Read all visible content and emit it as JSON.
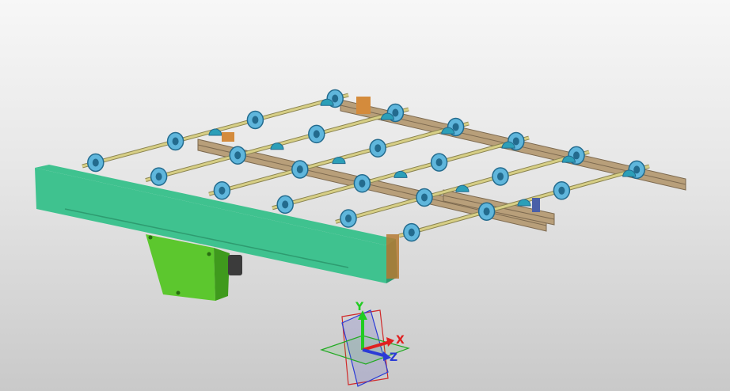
{
  "viewport": {
    "name": "3d-cad-viewport",
    "background_top": "#f7f7f7",
    "background_bottom": "#c9c9c9"
  },
  "model": {
    "roller_count": 6,
    "colors": {
      "main_beam": "#3fc28f",
      "main_beam_dark": "#2e9b70",
      "gearbox": "#5cc72e",
      "rail": "#b89f7a",
      "rail_dark": "#7d6a50",
      "shaft": "#d7cf86",
      "roller": "#5fb6dc",
      "roller_dark": "#236b8e",
      "bearing": "#2c9fb8",
      "bracket": "#d48b3c"
    }
  },
  "triad": {
    "x_label": "X",
    "y_label": "Y",
    "z_label": "Z",
    "x_color": "#e02020",
    "y_color": "#22cc22",
    "z_color": "#2b3bd6"
  }
}
